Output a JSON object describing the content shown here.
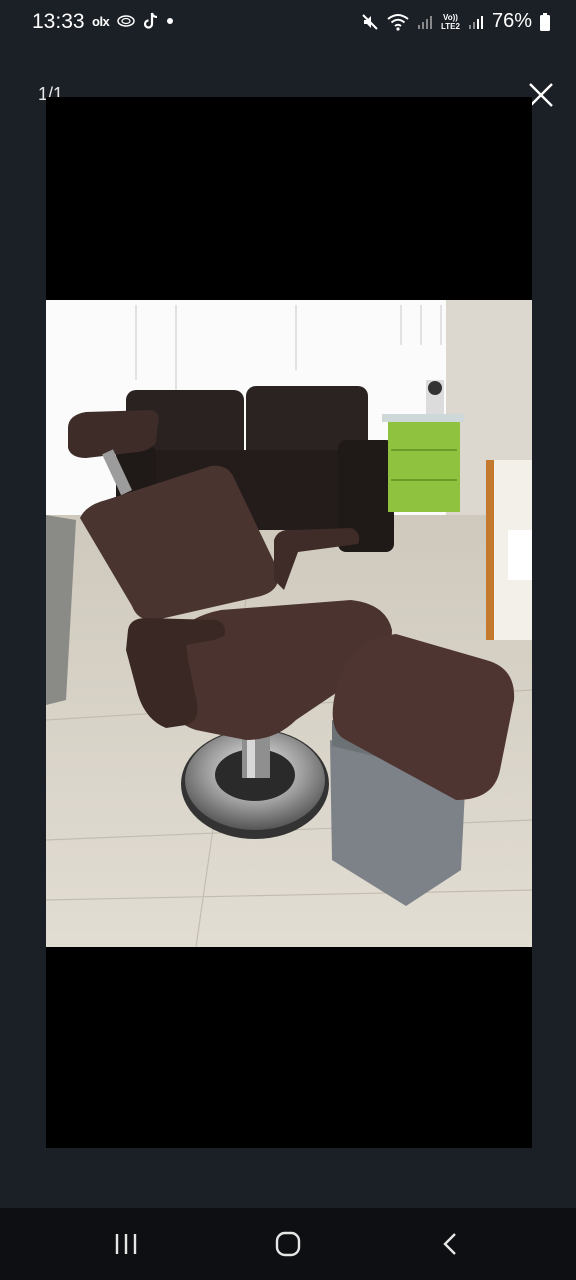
{
  "status_bar": {
    "time": "13:33",
    "left_icons": [
      "olx-icon",
      "cloud-icon",
      "tiktok-icon",
      "dot-icon"
    ],
    "olx_label": "olx",
    "network_label_top": "Vo))",
    "network_label_bottom": "LTE2",
    "battery": "76%"
  },
  "viewer": {
    "counter": "1/1",
    "close_icon": "close-icon"
  },
  "photo": {
    "description_colors": {
      "chair": "#4a3430",
      "sofa": "#2a2220",
      "cabinet": "#8fc23e",
      "floor": "#d9d2c6",
      "stool_base": "#7d8288"
    }
  },
  "navigation_bar": {
    "buttons": [
      "recent-apps-icon",
      "home-icon",
      "back-icon"
    ]
  }
}
